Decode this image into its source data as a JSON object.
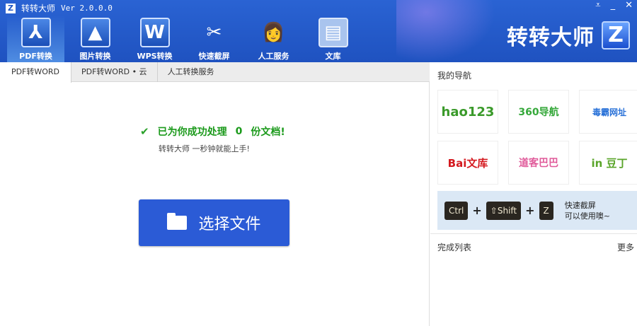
{
  "app": {
    "logo": "Z",
    "title": "转转大师",
    "version": "Ver 2.0.0.0",
    "brand": "转转大师",
    "brand_logo": "Z"
  },
  "window": {
    "menu": "⩡",
    "minimize": "_",
    "close": "✕"
  },
  "toolbar": [
    {
      "label": "PDF转换",
      "icon": "pdf-icon",
      "glyph": "⅄"
    },
    {
      "label": "图片转换",
      "icon": "image-icon",
      "glyph": "▲"
    },
    {
      "label": "WPS转换",
      "icon": "wps-icon",
      "glyph": "W"
    },
    {
      "label": "快速截屏",
      "icon": "scissors-icon",
      "glyph": "✂"
    },
    {
      "label": "人工服务",
      "icon": "nurse-icon",
      "glyph": "👩"
    },
    {
      "label": "文库",
      "icon": "book-icon",
      "glyph": "▤"
    }
  ],
  "tabs": [
    "PDF转WORD",
    "PDF转WORD • 云",
    "人工转换服务"
  ],
  "main": {
    "status_prefix": "已为你成功处理",
    "count": "0",
    "status_suffix": "份文档!",
    "subtitle": "转转大师 一秒钟就能上手!",
    "pick_button": "选择文件"
  },
  "side": {
    "nav_title": "我的导航",
    "links": [
      {
        "label": "hao123",
        "color": "#3a9a2a"
      },
      {
        "label": "360导航",
        "color": "#35a83a"
      },
      {
        "label": "毒霸网址",
        "color": "#2a72d8"
      },
      {
        "label": "Bai文库",
        "color": "#d4191f"
      },
      {
        "label": "道客巴巴",
        "color": "#e05a9a"
      },
      {
        "label": "in 豆丁",
        "color": "#5aa52a"
      }
    ],
    "banner": {
      "keys": [
        "Ctrl",
        "⇧Shift",
        "Z"
      ],
      "line1": "快速截屏",
      "line2": "可以使用噢~"
    },
    "done_title": "完成列表",
    "more": "更多"
  }
}
